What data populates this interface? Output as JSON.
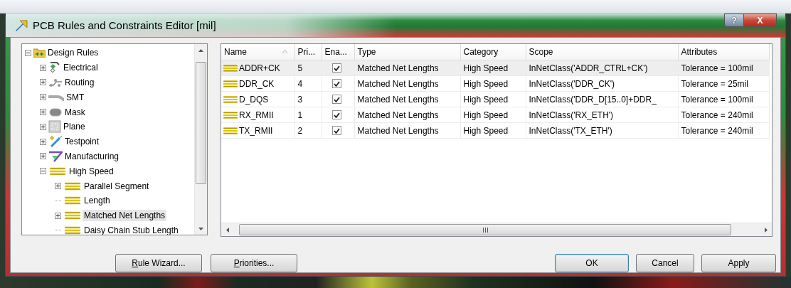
{
  "window": {
    "title": "PCB Rules and Constraints Editor [mil]",
    "help_button": "?",
    "close_button": "X"
  },
  "tree": {
    "items": [
      {
        "label": "Design Rules",
        "kind": "group",
        "expanded": true,
        "selected": false,
        "children": [
          {
            "label": "Electrical",
            "kind": "group",
            "expanded": false,
            "selected": false
          },
          {
            "label": "Routing",
            "kind": "group",
            "expanded": false,
            "selected": false
          },
          {
            "label": "SMT",
            "kind": "group",
            "expanded": false,
            "selected": false
          },
          {
            "label": "Mask",
            "kind": "group",
            "expanded": false,
            "selected": false
          },
          {
            "label": "Plane",
            "kind": "group",
            "expanded": false,
            "selected": false
          },
          {
            "label": "Testpoint",
            "kind": "group",
            "expanded": false,
            "selected": false
          },
          {
            "label": "Manufacturing",
            "kind": "group",
            "expanded": false,
            "selected": false
          },
          {
            "label": "High Speed",
            "kind": "group",
            "expanded": true,
            "selected": false,
            "children": [
              {
                "label": "Parallel Segment",
                "kind": "group",
                "expanded": false,
                "selected": false
              },
              {
                "label": "Length",
                "kind": "rule",
                "selected": false
              },
              {
                "label": "Matched Net Lengths",
                "kind": "group",
                "expanded": false,
                "selected": true
              },
              {
                "label": "Daisy Chain Stub Length",
                "kind": "rule",
                "selected": false
              }
            ]
          }
        ]
      }
    ]
  },
  "table": {
    "columns": [
      {
        "label": "Name",
        "sorted": true
      },
      {
        "label": "Pri...",
        "sorted": false
      },
      {
        "label": "Ena...",
        "sorted": false
      },
      {
        "label": "Type",
        "sorted": false
      },
      {
        "label": "Category",
        "sorted": false
      },
      {
        "label": "Scope",
        "sorted": false
      },
      {
        "label": "Attributes",
        "sorted": false
      }
    ],
    "rows": [
      {
        "name": "ADDR+CK",
        "priority": "5",
        "enabled": true,
        "type": "Matched Net Lengths",
        "category": "High Speed",
        "scope": "InNetClass('ADDR_CTRL+CK')",
        "attributes": "Tolerance = 100mil",
        "selected": true
      },
      {
        "name": "DDR_CK",
        "priority": "4",
        "enabled": true,
        "type": "Matched Net Lengths",
        "category": "High Speed",
        "scope": "InNetClass('DDR_CK')",
        "attributes": "Tolerance = 25mil",
        "selected": false
      },
      {
        "name": "D_DQS",
        "priority": "3",
        "enabled": true,
        "type": "Matched Net Lengths",
        "category": "High Speed",
        "scope": "InNetClass('DDR_D[15..0]+DDR_",
        "attributes": "Tolerance = 100mil",
        "selected": false
      },
      {
        "name": "RX_RMII",
        "priority": "1",
        "enabled": true,
        "type": "Matched Net Lengths",
        "category": "High Speed",
        "scope": "InNetClass('RX_ETH')",
        "attributes": "Tolerance = 240mil",
        "selected": false
      },
      {
        "name": "TX_RMII",
        "priority": "2",
        "enabled": true,
        "type": "Matched Net Lengths",
        "category": "High Speed",
        "scope": "InNetClass('TX_ETH')",
        "attributes": "Tolerance = 240mil",
        "selected": false
      }
    ]
  },
  "buttons": {
    "left": [
      {
        "label": "Rule Wizard...",
        "mnemonic": true,
        "default": false
      },
      {
        "label": "Priorities...",
        "mnemonic": true,
        "default": false
      }
    ],
    "right": [
      {
        "label": "OK",
        "mnemonic": false,
        "default": true
      },
      {
        "label": "Cancel",
        "mnemonic": false,
        "default": false
      },
      {
        "label": "Apply",
        "mnemonic": false,
        "default": false
      }
    ]
  }
}
